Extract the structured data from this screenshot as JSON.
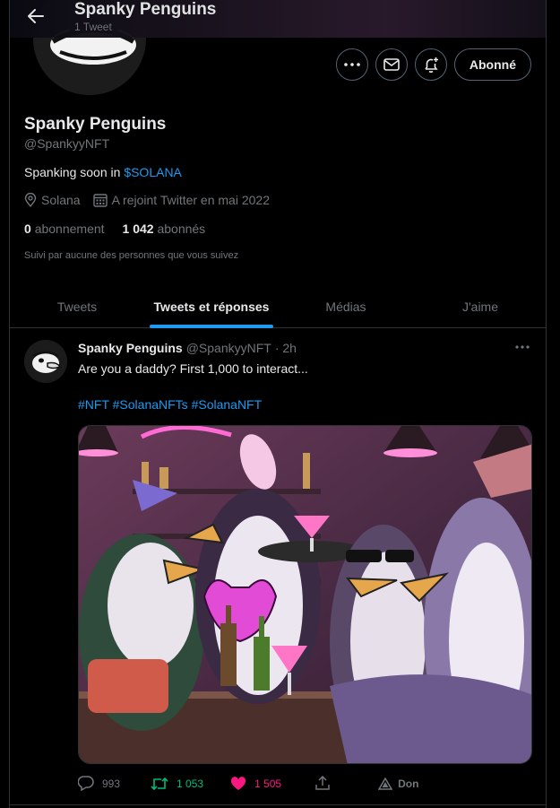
{
  "header": {
    "title": "Spanky Penguins",
    "tweet_count": "1 Tweet"
  },
  "profile": {
    "name": "Spanky Penguins",
    "handle": "@SpankyyNFT",
    "bio_prefix": "Spanking soon in ",
    "bio_link": "$SOLANA",
    "location": "Solana",
    "joined": "A rejoint Twitter en mai 2022",
    "following_count": "0",
    "following_label": "abonnement",
    "followers_count": "1 042",
    "followers_label": "abonnés",
    "followed_by": "Suivi par aucune des personnes que vous suivez",
    "follow_button": "Abonné"
  },
  "tabs": [
    {
      "label": "Tweets",
      "active": false
    },
    {
      "label": "Tweets et réponses",
      "active": true
    },
    {
      "label": "Médias",
      "active": false
    },
    {
      "label": "J'aime",
      "active": false
    }
  ],
  "tweet": {
    "name": "Spanky Penguins",
    "handle": "@SpankyyNFT",
    "time": "· 2h",
    "text": "Are you a daddy? First 1,000 to interact...",
    "hashtags": "#NFT #SolanaNFTs #SolanaNFT",
    "replies": "993",
    "retweets": "1 053",
    "likes": "1 505",
    "tip_label": "Don"
  },
  "colors": {
    "accent": "#1d9bf0",
    "retweet": "#00ba7c",
    "like": "#f91880",
    "muted": "#71767b",
    "background": "#000000"
  },
  "icons": [
    "back-arrow-icon",
    "more-icon",
    "mail-icon",
    "notification-bell-icon",
    "location-icon",
    "calendar-icon",
    "reply-icon",
    "retweet-icon",
    "heart-icon",
    "share-icon",
    "tip-icon"
  ]
}
